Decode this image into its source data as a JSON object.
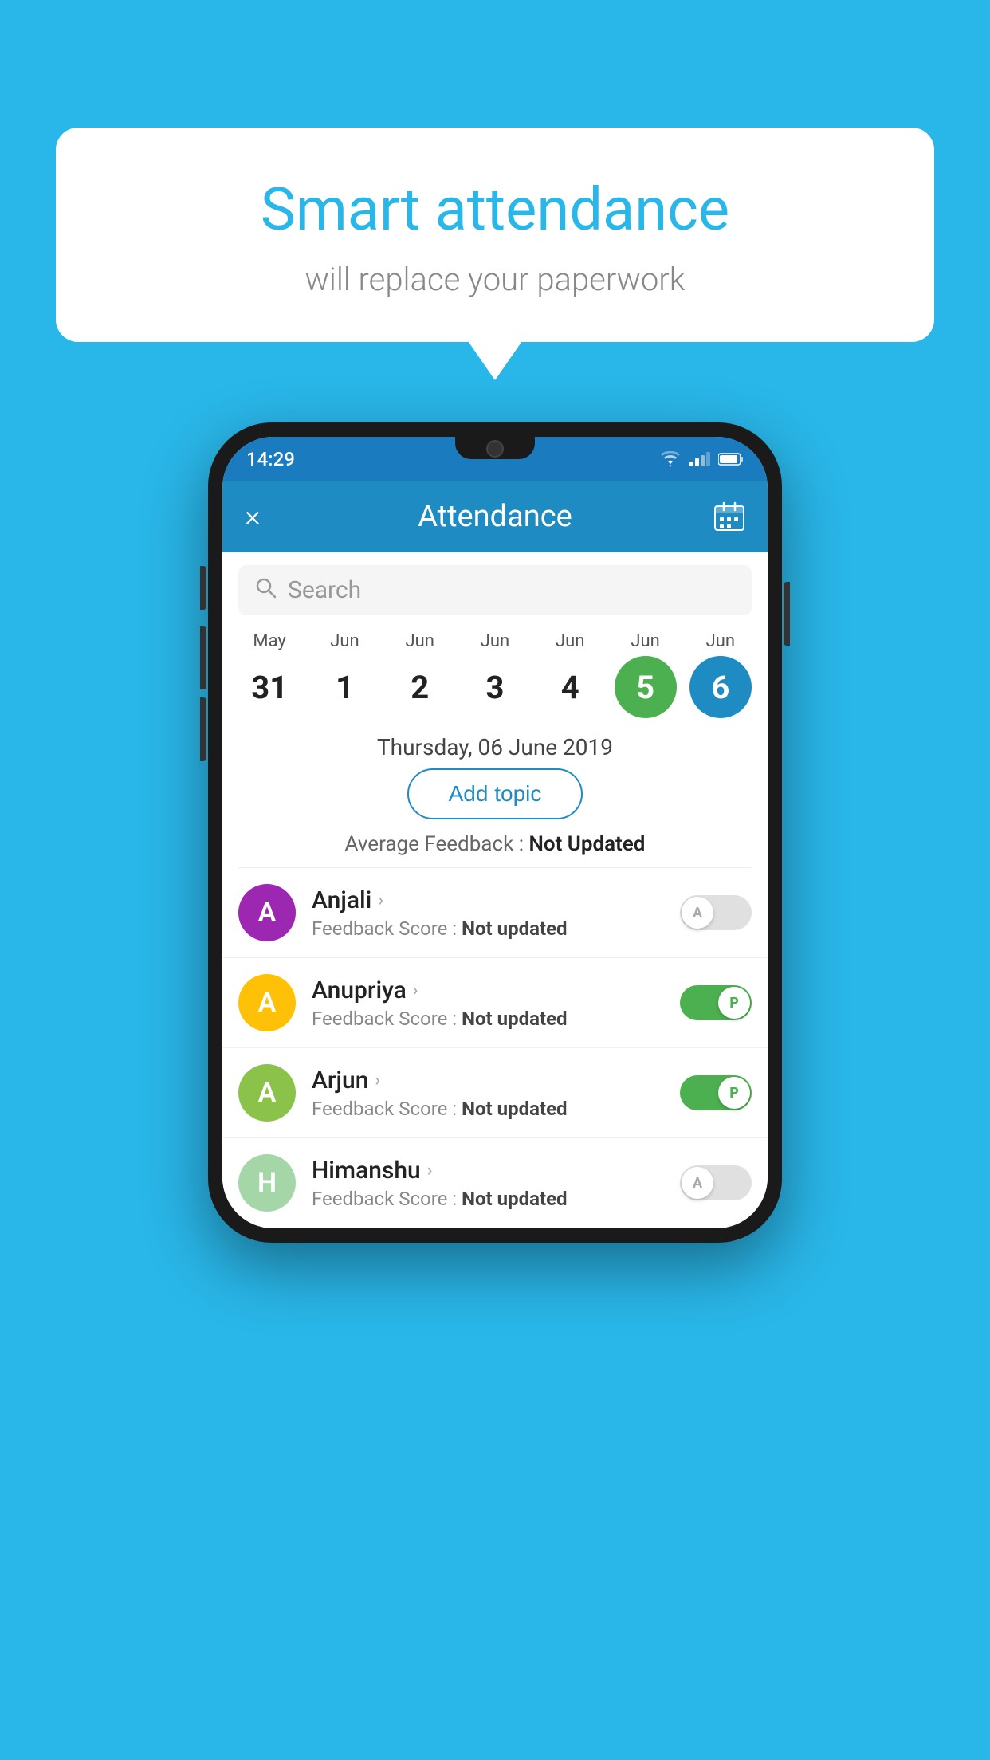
{
  "page": {
    "background_color": "#29b6e8"
  },
  "speech_bubble": {
    "title": "Smart attendance",
    "subtitle": "will replace your paperwork"
  },
  "status_bar": {
    "time": "14:29"
  },
  "toolbar": {
    "title": "Attendance",
    "close_label": "×",
    "calendar_label": "📅"
  },
  "search": {
    "placeholder": "Search"
  },
  "calendar": {
    "days": [
      {
        "month": "May",
        "date": "31",
        "type": "normal"
      },
      {
        "month": "Jun",
        "date": "1",
        "type": "normal"
      },
      {
        "month": "Jun",
        "date": "2",
        "type": "normal"
      },
      {
        "month": "Jun",
        "date": "3",
        "type": "normal"
      },
      {
        "month": "Jun",
        "date": "4",
        "type": "normal"
      },
      {
        "month": "Jun",
        "date": "5",
        "type": "today"
      },
      {
        "month": "Jun",
        "date": "6",
        "type": "selected"
      }
    ],
    "selected_date_label": "Thursday, 06 June 2019"
  },
  "add_topic_button": "Add topic",
  "average_feedback": {
    "label": "Average Feedback :",
    "value": "Not Updated"
  },
  "students": [
    {
      "name": "Anjali",
      "initial": "A",
      "avatar_color": "#9c27b0",
      "feedback_label": "Feedback Score :",
      "feedback_value": "Not updated",
      "toggle": "off"
    },
    {
      "name": "Anupriya",
      "initial": "A",
      "avatar_color": "#ffc107",
      "feedback_label": "Feedback Score :",
      "feedback_value": "Not updated",
      "toggle": "on"
    },
    {
      "name": "Arjun",
      "initial": "A",
      "avatar_color": "#8bc34a",
      "feedback_label": "Feedback Score :",
      "feedback_value": "Not updated",
      "toggle": "on"
    },
    {
      "name": "Himanshu",
      "initial": "H",
      "avatar_color": "#a5d6a7",
      "feedback_label": "Feedback Score :",
      "feedback_value": "Not updated",
      "toggle": "off"
    }
  ],
  "toggle_labels": {
    "present": "P",
    "absent": "A"
  }
}
